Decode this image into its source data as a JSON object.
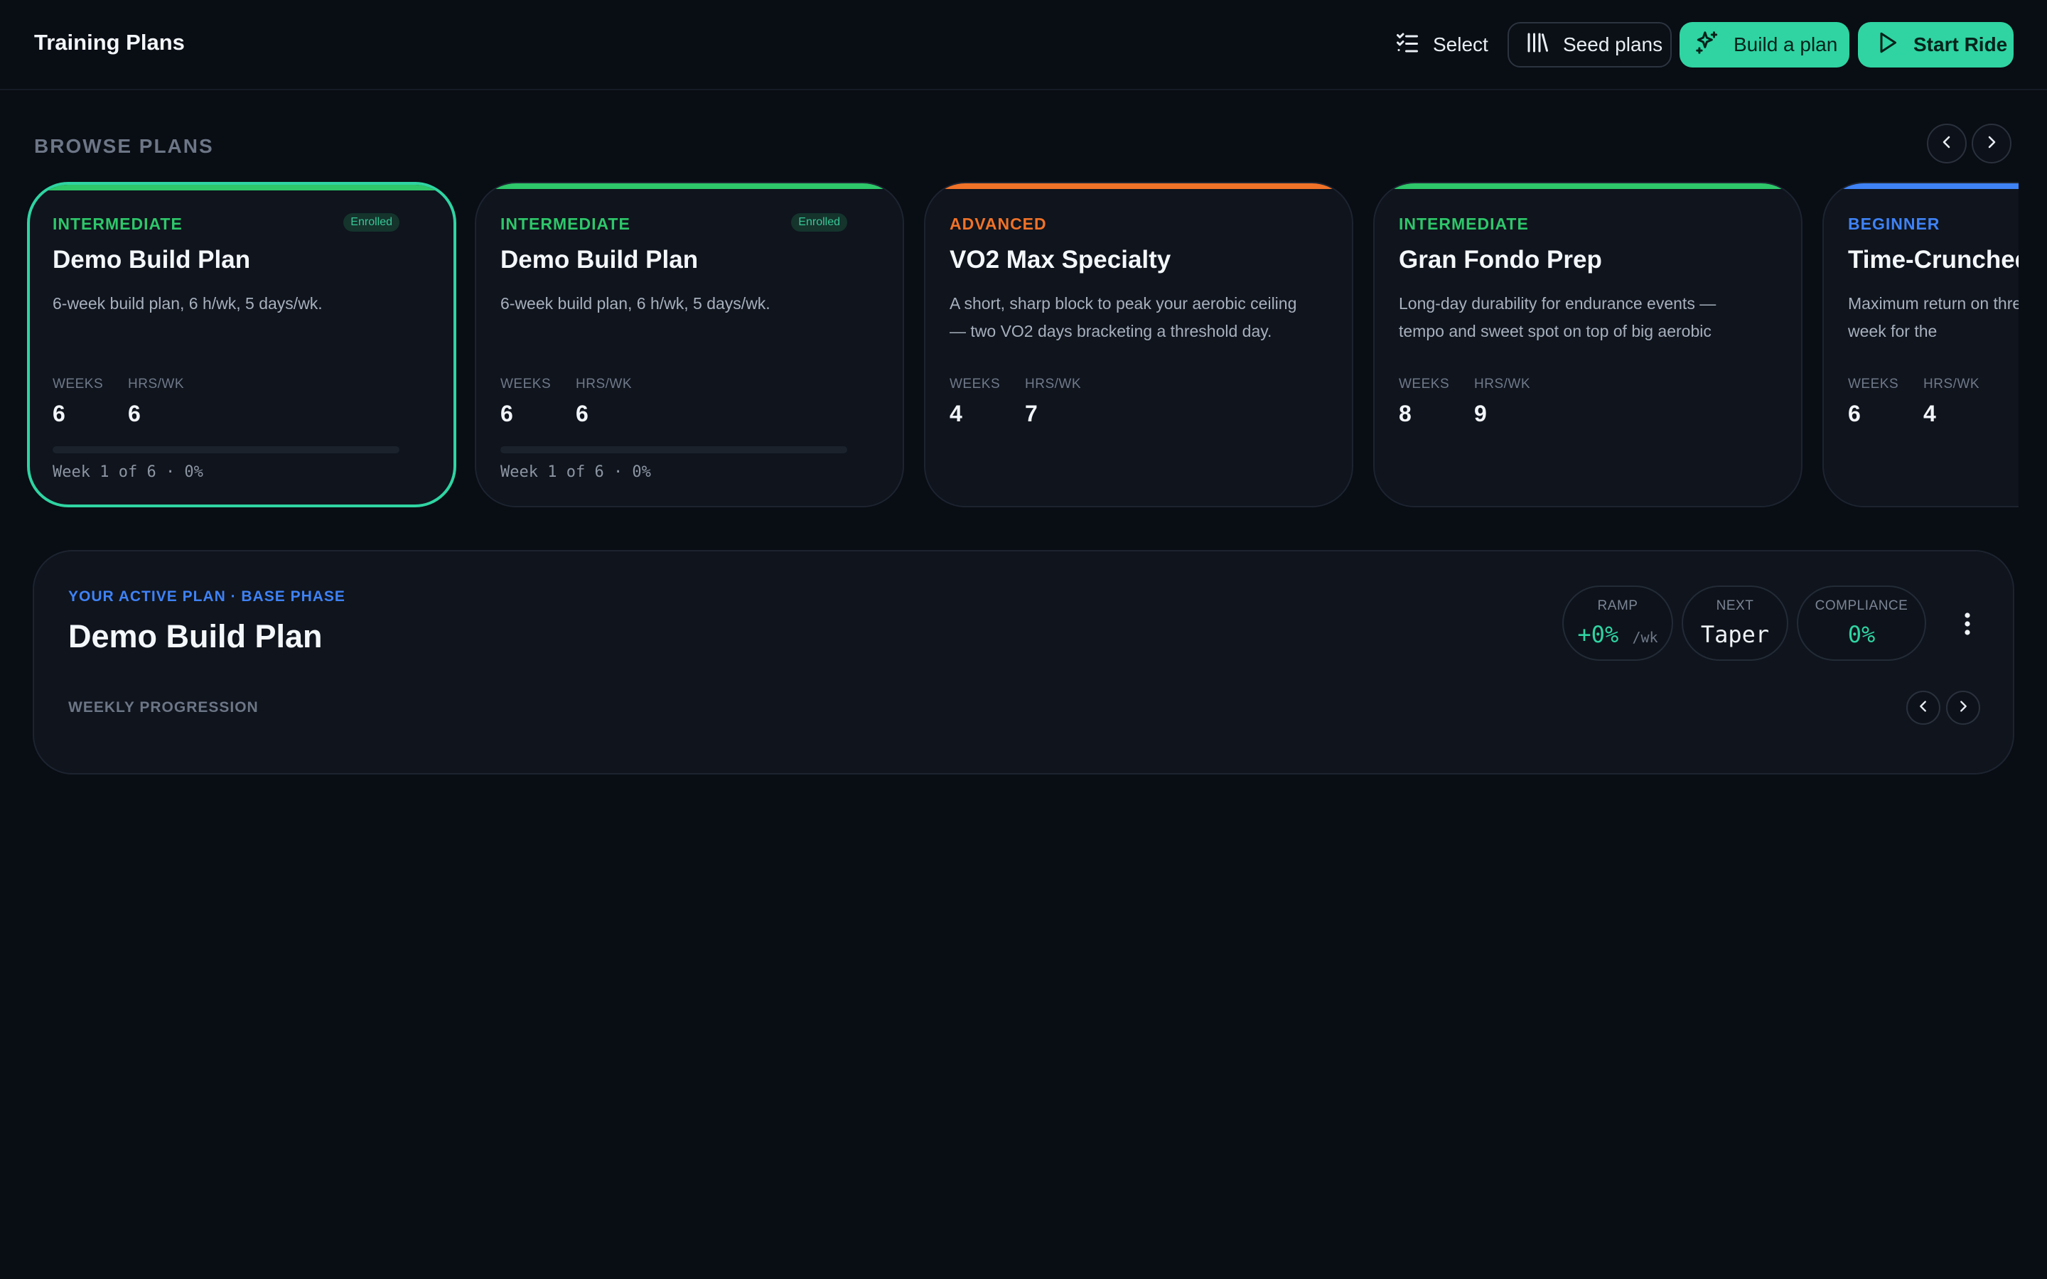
{
  "header": {
    "title": "Training Plans",
    "select_label": "Select",
    "seed_label": "Seed plans",
    "build_label": "Build a plan",
    "start_label": "Start Ride"
  },
  "browse": {
    "title": "BROWSE PLANS",
    "cards": [
      {
        "level": "INTERMEDIATE",
        "level_color": "#2ec76a",
        "badge": "Enrolled",
        "name": "Demo Build Plan",
        "desc": "6-week build plan, 6 h/wk, 5 days/wk.",
        "weeks_label": "WEEKS",
        "weeks": "6",
        "hrs_label": "HRS/WK",
        "hrs": "6",
        "progress_fraction": 0,
        "progress_text": "Week 1 of 6 · 0%",
        "selected": true
      },
      {
        "level": "INTERMEDIATE",
        "level_color": "#2ec76a",
        "badge": "Enrolled",
        "name": "Demo Build Plan",
        "desc": "6-week build plan, 6 h/wk, 5 days/wk.",
        "weeks_label": "WEEKS",
        "weeks": "6",
        "hrs_label": "HRS/WK",
        "hrs": "6",
        "progress_fraction": 0,
        "progress_text": "Week 1 of 6 · 0%"
      },
      {
        "level": "ADVANCED",
        "level_color": "#f07228",
        "name": "VO2 Max Specialty",
        "desc": "A short, sharp block to peak your aerobic ceiling — two VO2 days bracketing a threshold day.",
        "weeks_label": "WEEKS",
        "weeks": "4",
        "hrs_label": "HRS/WK",
        "hrs": "7"
      },
      {
        "level": "INTERMEDIATE",
        "level_color": "#2ec76a",
        "name": "Gran Fondo Prep",
        "desc": "Long-day durability for endurance events — tempo and sweet spot on top of big aerobic volume.",
        "weeks_label": "WEEKS",
        "weeks": "8",
        "hrs_label": "HRS/WK",
        "hrs": "9"
      },
      {
        "level": "BEGINNER",
        "level_color": "#3f82f5",
        "name": "Time-Crunched",
        "desc": "Maximum return on three sessions a week for the",
        "weeks_label": "WEEKS",
        "weeks": "6",
        "hrs_label": "HRS/WK",
        "hrs": "4"
      }
    ]
  },
  "active_plan": {
    "eyebrow": "YOUR ACTIVE PLAN · BASE PHASE",
    "title": "Demo Build Plan",
    "weekly_label": "WEEKLY PROGRESSION",
    "ramp_label": "RAMP",
    "ramp_value": "+0%",
    "ramp_unit": "/wk",
    "next_label": "NEXT",
    "next_value": "Taper",
    "compliance_label": "COMPLIANCE",
    "compliance_value": "0%"
  },
  "colors": {
    "accent": "#2fd4a2",
    "intermediate": "#2ec76a",
    "advanced": "#f07228",
    "beginner": "#3f82f5"
  },
  "icons": {
    "select": "checklist-icon",
    "seed": "library-icon",
    "build": "sparkles-icon",
    "start": "play-icon",
    "prev": "chevron-left-icon",
    "next": "chevron-right-icon",
    "more": "kebab-menu-icon"
  }
}
